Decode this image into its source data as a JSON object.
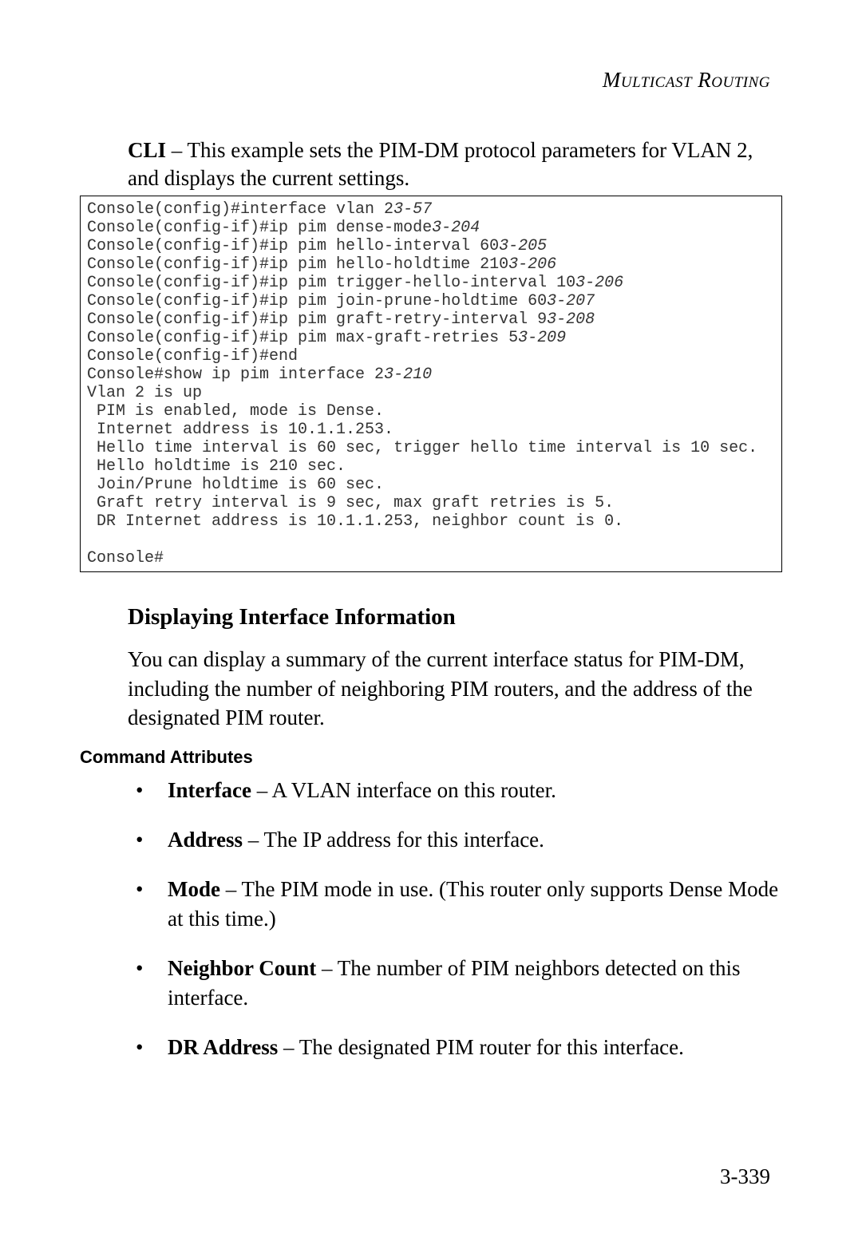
{
  "header": "Multicast Routing",
  "intro_bold": "CLI",
  "intro_rest": " – This example sets the PIM-DM protocol parameters for VLAN 2, and displays the current settings.",
  "code": {
    "l1a": "Console(config)#interface vlan 2",
    "l1b": "3-57",
    "l2a": "Console(config-if)#ip pim dense-mode",
    "l2b": "3-204",
    "l3a": "Console(config-if)#ip pim hello-interval 60",
    "l3b": "3-205",
    "l4a": "Console(config-if)#ip pim hello-holdtime 210",
    "l4b": "3-206",
    "l5a": "Console(config-if)#ip pim trigger-hello-interval 10",
    "l5b": "3-206",
    "l6a": "Console(config-if)#ip pim join-prune-holdtime 60",
    "l6b": "3-207",
    "l7a": "Console(config-if)#ip pim graft-retry-interval 9",
    "l7b": "3-208",
    "l8a": "Console(config-if)#ip pim max-graft-retries 5",
    "l8b": "3-209",
    "l9": "Console(config-if)#end",
    "l10a": "Console#show ip pim interface 2",
    "l10b": "3-210",
    "l11": "Vlan 2 is up",
    "l12": " PIM is enabled, mode is Dense.",
    "l13": " Internet address is 10.1.1.253.",
    "l14": " Hello time interval is 60 sec, trigger hello time interval is 10 sec.",
    "l15": " Hello holdtime is 210 sec.",
    "l16": " Join/Prune holdtime is 60 sec.",
    "l17": " Graft retry interval is 9 sec, max graft retries is 5.",
    "l18": " DR Internet address is 10.1.1.253, neighbor count is 0.",
    "l19": "",
    "l20": "Console#"
  },
  "section_title": "Displaying Interface Information",
  "section_body": "You can display a summary of the current interface status for PIM-DM, including the number of neighboring PIM routers, and the address of the designated PIM router.",
  "attr_header": "Command Attributes",
  "attrs": [
    {
      "term": "Interface",
      "desc": " – A VLAN interface on this router."
    },
    {
      "term": "Address",
      "desc": " – The IP address for this interface."
    },
    {
      "term": "Mode",
      "desc": " – The PIM mode in use. (This router only supports Dense Mode at this time.)"
    },
    {
      "term": "Neighbor Count",
      "desc": " – The number of PIM neighbors detected on this interface."
    },
    {
      "term": "DR Address",
      "desc": " – The designated PIM router for this interface."
    }
  ],
  "page_num": "3-339",
  "chart_data": {
    "type": "table",
    "title": "PIM-DM interface configuration and status",
    "config_commands": [
      {
        "command": "interface vlan 2",
        "page_ref": "3-57"
      },
      {
        "command": "ip pim dense-mode",
        "page_ref": "3-204"
      },
      {
        "command": "ip pim hello-interval 60",
        "page_ref": "3-205"
      },
      {
        "command": "ip pim hello-holdtime 210",
        "page_ref": "3-206"
      },
      {
        "command": "ip pim trigger-hello-interval 10",
        "page_ref": "3-206"
      },
      {
        "command": "ip pim join-prune-holdtime 60",
        "page_ref": "3-207"
      },
      {
        "command": "ip pim graft-retry-interval 9",
        "page_ref": "3-208"
      },
      {
        "command": "ip pim max-graft-retries 5",
        "page_ref": "3-209"
      },
      {
        "command": "end",
        "page_ref": ""
      },
      {
        "command": "show ip pim interface 2",
        "page_ref": "3-210"
      }
    ],
    "interface_status": {
      "vlan": 2,
      "state": "up",
      "pim_enabled": true,
      "mode": "Dense",
      "internet_address": "10.1.1.253",
      "hello_time_interval_sec": 60,
      "trigger_hello_time_interval_sec": 10,
      "hello_holdtime_sec": 210,
      "join_prune_holdtime_sec": 60,
      "graft_retry_interval_sec": 9,
      "max_graft_retries": 5,
      "dr_internet_address": "10.1.1.253",
      "neighbor_count": 0
    }
  }
}
